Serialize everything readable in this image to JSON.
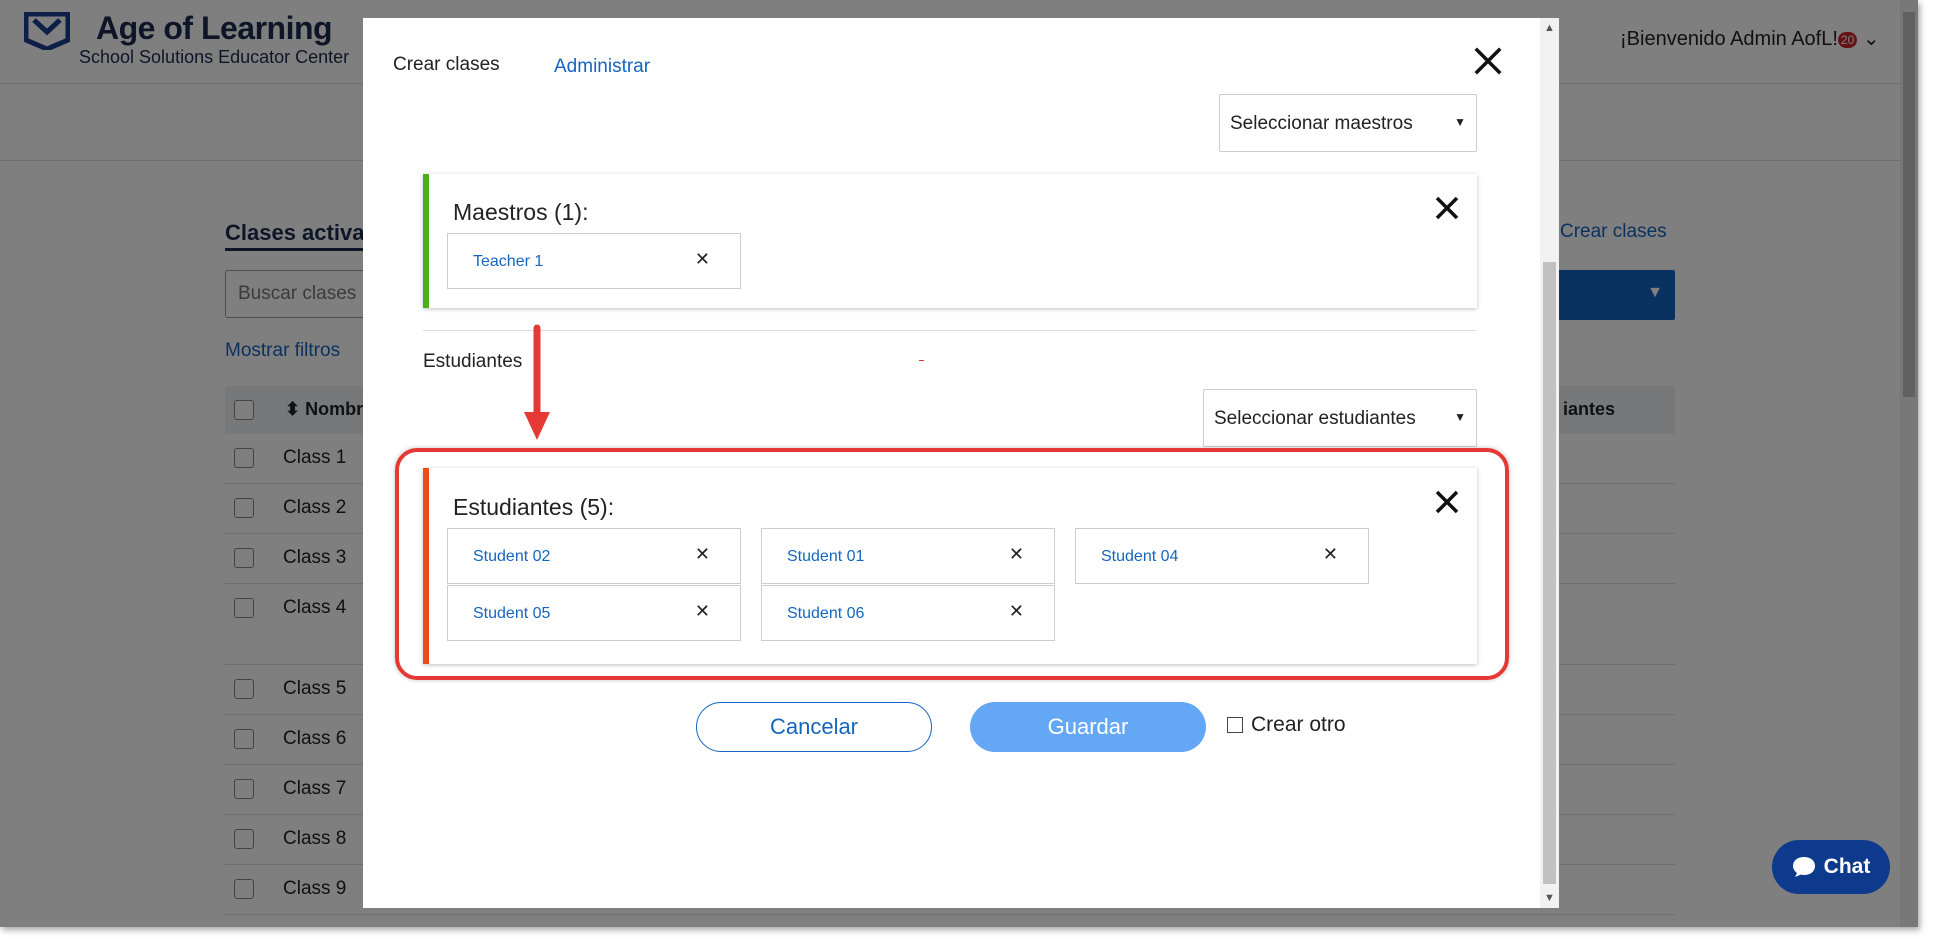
{
  "header": {
    "logo_title": "Age of Learning",
    "logo_sub": "School Solutions Educator Center",
    "user_greeting": "¡Bienvenido Admin AofL!",
    "notification_count": "20"
  },
  "background": {
    "title": "Clases activa",
    "search_placeholder": "Buscar clases",
    "show_filters": "Mostrar filtros",
    "create_link": "Crear clases",
    "col_name": "Nombr",
    "col_students": "iantes",
    "rows": [
      "Class 1",
      "Class 2",
      "Class 3",
      "Class 4",
      "Class 5",
      "Class 6",
      "Class 7",
      "Class 8",
      "Class 9"
    ]
  },
  "chat": {
    "label": "Chat"
  },
  "modal": {
    "tab_create": "Crear clases",
    "tab_admin": "Administrar",
    "select_teachers": "Seleccionar maestros",
    "teachers_title": "Maestros (1):",
    "teachers": [
      {
        "name": "Teacher 1"
      }
    ],
    "students_section": "Estudiantes",
    "select_students": "Seleccionar estudiantes",
    "students_title": "Estudiantes (5):",
    "students": [
      {
        "name": "Student 02"
      },
      {
        "name": "Student 01"
      },
      {
        "name": "Student 04"
      },
      {
        "name": "Student 05"
      },
      {
        "name": "Student 06"
      }
    ],
    "remove_glyph": "✕",
    "cancel": "Cancelar",
    "save": "Guardar",
    "create_other": "Crear otro"
  },
  "colors": {
    "teachers_accent": "#4caf1a",
    "students_accent": "#ef4b16",
    "highlight": "#e53935",
    "link": "#1565c0",
    "save_button": "#64a8f5"
  }
}
